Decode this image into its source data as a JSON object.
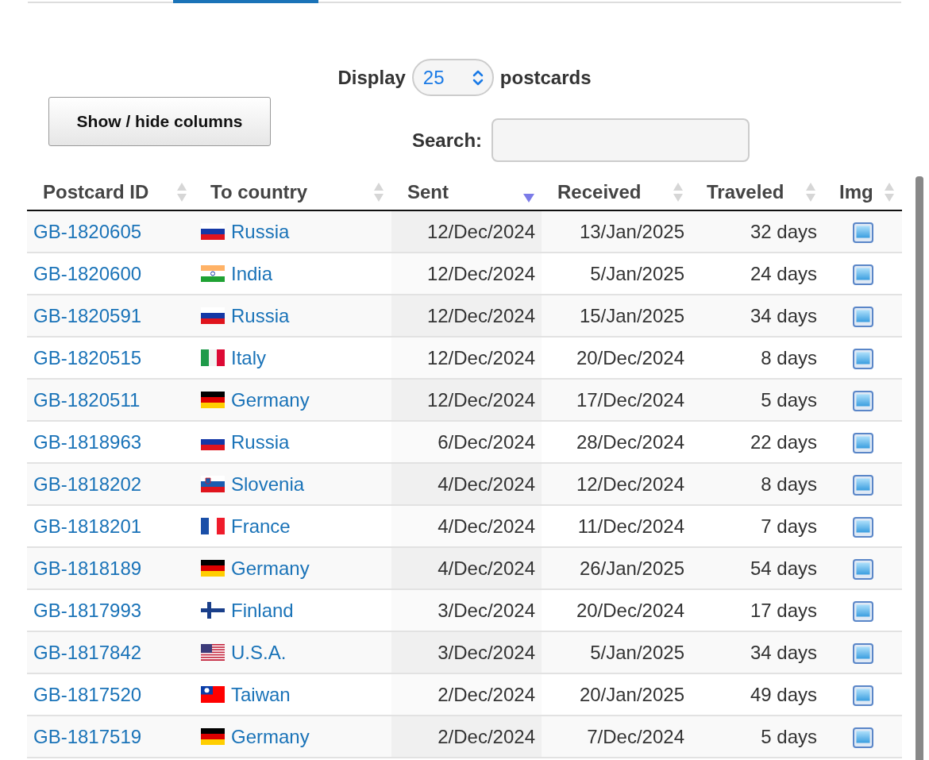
{
  "length_control": {
    "before": "Display",
    "value": "25",
    "after": "postcards"
  },
  "columns_button": "Show / hide columns",
  "search": {
    "label": "Search:"
  },
  "table": {
    "columns": [
      {
        "label": "Postcard ID",
        "kind": "sortable"
      },
      {
        "label": "To country",
        "kind": "sortable"
      },
      {
        "label": "Sent",
        "kind": "descending"
      },
      {
        "label": "Received",
        "kind": "sortable"
      },
      {
        "label": "Traveled",
        "kind": "sortable"
      },
      {
        "label": "Img",
        "kind": "sortable"
      }
    ],
    "rows": [
      {
        "id": "GB-1820605",
        "flag": {
          "kind": "ru"
        },
        "country": "Russia",
        "sent": "12/Dec/2024",
        "received": "13/Jan/2025",
        "traveled": "32 days"
      },
      {
        "id": "GB-1820600",
        "flag": {
          "kind": "in"
        },
        "country": "India",
        "sent": "12/Dec/2024",
        "received": "5/Jan/2025",
        "traveled": "24 days"
      },
      {
        "id": "GB-1820591",
        "flag": {
          "kind": "ru"
        },
        "country": "Russia",
        "sent": "12/Dec/2024",
        "received": "15/Jan/2025",
        "traveled": "34 days"
      },
      {
        "id": "GB-1820515",
        "flag": {
          "kind": "it"
        },
        "country": "Italy",
        "sent": "12/Dec/2024",
        "received": "20/Dec/2024",
        "traveled": "8 days"
      },
      {
        "id": "GB-1820511",
        "flag": {
          "kind": "de"
        },
        "country": "Germany",
        "sent": "12/Dec/2024",
        "received": "17/Dec/2024",
        "traveled": "5 days"
      },
      {
        "id": "GB-1818963",
        "flag": {
          "kind": "ru"
        },
        "country": "Russia",
        "sent": "6/Dec/2024",
        "received": "28/Dec/2024",
        "traveled": "22 days"
      },
      {
        "id": "GB-1818202",
        "flag": {
          "kind": "si"
        },
        "country": "Slovenia",
        "sent": "4/Dec/2024",
        "received": "12/Dec/2024",
        "traveled": "8 days"
      },
      {
        "id": "GB-1818201",
        "flag": {
          "kind": "fr"
        },
        "country": "France",
        "sent": "4/Dec/2024",
        "received": "11/Dec/2024",
        "traveled": "7 days"
      },
      {
        "id": "GB-1818189",
        "flag": {
          "kind": "de"
        },
        "country": "Germany",
        "sent": "4/Dec/2024",
        "received": "26/Jan/2025",
        "traveled": "54 days"
      },
      {
        "id": "GB-1817993",
        "flag": {
          "kind": "fi"
        },
        "country": "Finland",
        "sent": "3/Dec/2024",
        "received": "20/Dec/2024",
        "traveled": "17 days"
      },
      {
        "id": "GB-1817842",
        "flag": {
          "kind": "us"
        },
        "country": "U.S.A.",
        "sent": "3/Dec/2024",
        "received": "5/Jan/2025",
        "traveled": "34 days"
      },
      {
        "id": "GB-1817520",
        "flag": {
          "kind": "tw"
        },
        "country": "Taiwan",
        "sent": "2/Dec/2024",
        "received": "20/Jan/2025",
        "traveled": "49 days"
      },
      {
        "id": "GB-1817519",
        "flag": {
          "kind": "de"
        },
        "country": "Germany",
        "sent": "2/Dec/2024",
        "received": "7/Dec/2024",
        "traveled": "5 days"
      }
    ]
  }
}
